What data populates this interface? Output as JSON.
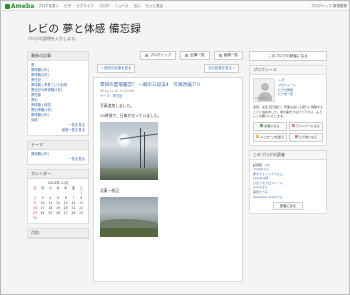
{
  "topbar": {
    "logo": "Ameba",
    "nav": [
      "ブログを書く",
      "ピグ",
      "ピグライフ",
      "ブログ",
      "ニュース",
      "占い",
      "もっと見る"
    ],
    "right": "ブログトップ 新規登録"
  },
  "header": {
    "title": "レビの 夢と体感 備忘録",
    "description": "ブログの説明を入力します。"
  },
  "left": {
    "themes_head": "最新の記事",
    "themes": [
      "夢",
      "夢体験(1件)",
      "夢体験(2件)",
      "夢日記",
      "夢体験 | 夢見ていた記憶",
      "夢日記の夢体験(2件)",
      "夢記録",
      "夢幻",
      "夢体験 | 体感",
      "夢幻体験(1件)",
      "夢体験(1件)",
      "体感"
    ],
    "themes_more": "一覧を見る",
    "themes_more2": "最新一覧を見る",
    "theme_head": "テーマ",
    "theme_items": [
      "夢体験(1件)"
    ],
    "theme_more": "一覧を見る",
    "cal_head": "カレンダー",
    "cal_title": "2014年 11月",
    "cal_days": [
      "日",
      "月",
      "火",
      "水",
      "木",
      "金",
      "土"
    ],
    "cal_dates": [
      "",
      "",
      "",
      "",
      "",
      "",
      "1",
      "2",
      "3",
      "4",
      "5",
      "6",
      "7",
      "8",
      "9",
      "10",
      "11",
      "12",
      "13",
      "14",
      "15",
      "16",
      "17",
      "18",
      "19",
      "20",
      "21",
      "22",
      "23",
      "24",
      "25",
      "26",
      "27",
      "28",
      "29",
      "30",
      "",
      "",
      "",
      "",
      ""
    ],
    "archive_head": "月別"
  },
  "main": {
    "tabs": [
      "ブログトップ",
      "記事一覧",
      "画像一覧"
    ],
    "prev": "« 前回の記事を見る",
    "next": "次の記事を見る »",
    "entry_title": "零研の霊場露営？ 一端の三段法4　写真改編アリ",
    "entry_date": "2014-11-15 13:33:06",
    "entry_theme": "テーマ：夢日記",
    "entry_line1": "写真追加しました。",
    "entry_line2": "10時頃で、日傘が太っていました。",
    "entry_line3": "北東一前辺"
  },
  "right": {
    "reader_button": "このブログの読者になる",
    "profile_head": "プロフィール",
    "profile_name": "レビ",
    "profile_links": [
      "プロフィール",
      "ピグの部屋",
      "ピグ友一覧"
    ],
    "avatar_caption": "No Image",
    "profile_text": "性別：女性 自己紹介：何事も感じる通りに体験することに決めました。前の事をつなげて下さい。よろしくお願いいたします。",
    "profile_buttons": [
      "読者になる",
      "アメンバーになる",
      "メッセージを送る",
      "ピグ友になる"
    ],
    "readers_head": "このブログの読者",
    "readers_count": "読者数：3人",
    "readers": [
      "miyabiさん",
      "夢のマトリックスさん",
      "kira.kira様",
      "ひかりのプロフィール",
      "yumeさん",
      "夢見たつ子",
      "hamaoka_mamiさん"
    ],
    "readers_more": "読者になる"
  }
}
